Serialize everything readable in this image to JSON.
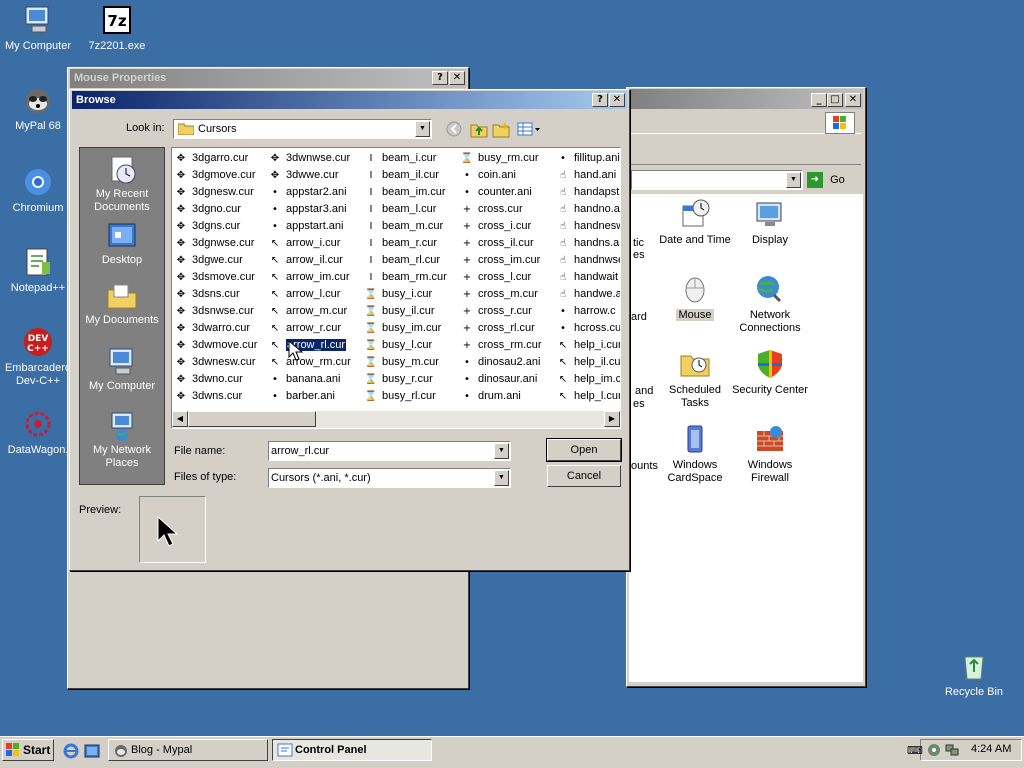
{
  "desktop": {
    "icons": [
      {
        "label": "My Computer"
      },
      {
        "label": "7z2201.exe"
      },
      {
        "label": "MyPal 68"
      },
      {
        "label": "Chromium"
      },
      {
        "label": "Notepad++"
      },
      {
        "label": "Embarcadero Dev-C++"
      },
      {
        "label": "DataWagon."
      },
      {
        "label": "Recycle Bin"
      }
    ],
    "background_color": "#3a6ea5"
  },
  "mouse_properties": {
    "title": "Mouse Properties"
  },
  "browse": {
    "title": "Browse",
    "help_btn": "?",
    "close_btn": "✕",
    "look_in_label": "Look in:",
    "look_in_value": "Cursors",
    "places": [
      "My Recent Documents",
      "Desktop",
      "My Documents",
      "My Computer",
      "My Network Places"
    ],
    "columns": [
      [
        "3dgarro.cur",
        "3dgmove.cur",
        "3dgnesw.cur",
        "3dgno.cur",
        "3dgns.cur",
        "3dgnwse.cur",
        "3dgwe.cur",
        "3dsmove.cur",
        "3dsns.cur",
        "3dsnwse.cur",
        "3dwarro.cur",
        "3dwmove.cur",
        "3dwnesw.cur",
        "3dwno.cur",
        "3dwns.cur"
      ],
      [
        "3dwnwse.cur",
        "3dwwe.cur",
        "appstar2.ani",
        "appstar3.ani",
        "appstart.ani",
        "arrow_i.cur",
        "arrow_il.cur",
        "arrow_im.cur",
        "arrow_l.cur",
        "arrow_m.cur",
        "arrow_r.cur",
        "arrow_rl.cur",
        "arrow_rm.cur",
        "banana.ani",
        "barber.ani"
      ],
      [
        "beam_i.cur",
        "beam_il.cur",
        "beam_im.cur",
        "beam_l.cur",
        "beam_m.cur",
        "beam_r.cur",
        "beam_rl.cur",
        "beam_rm.cur",
        "busy_i.cur",
        "busy_il.cur",
        "busy_im.cur",
        "busy_l.cur",
        "busy_m.cur",
        "busy_r.cur",
        "busy_rl.cur"
      ],
      [
        "busy_rm.cur",
        "coin.ani",
        "counter.ani",
        "cross.cur",
        "cross_i.cur",
        "cross_il.cur",
        "cross_im.cur",
        "cross_l.cur",
        "cross_m.cur",
        "cross_r.cur",
        "cross_rl.cur",
        "cross_rm.cur",
        "dinosau2.ani",
        "dinosaur.ani",
        "drum.ani"
      ],
      [
        "fillitup.ani",
        "hand.ani",
        "handapst",
        "handno.a",
        "handnesw",
        "handns.a",
        "handnwse",
        "handwait",
        "handwe.a",
        "harrow.c",
        "hcross.cu",
        "help_i.cur",
        "help_il.cu",
        "help_im.cu",
        "help_l.cur"
      ]
    ],
    "selected": "arrow_rl.cur",
    "file_name_label": "File name:",
    "file_name_value": "arrow_rl.cur",
    "file_type_label": "Files of type:",
    "file_type_value": "Cursors (*.ani, *.cur)",
    "open_btn": "Open",
    "cancel_btn": "Cancel",
    "preview_label": "Preview:"
  },
  "control_panel": {
    "title": "Control Panel",
    "go_btn": "Go",
    "items": [
      {
        "label": "Date and Time"
      },
      {
        "label": "Display"
      },
      {
        "label": "Mouse"
      },
      {
        "label": "Network Connections"
      },
      {
        "label": "Scheduled Tasks"
      },
      {
        "label": "Security Center"
      },
      {
        "label": "Windows CardSpace"
      },
      {
        "label": "Windows Firewall"
      }
    ],
    "partial_labels": [
      "tic",
      "es",
      "ard",
      "and",
      "es",
      "ounts"
    ]
  },
  "taskbar": {
    "start": "Start",
    "tasks": [
      {
        "label": "Blog - Mypal"
      },
      {
        "label": "Control Panel"
      }
    ],
    "clock": "4:24 AM"
  }
}
